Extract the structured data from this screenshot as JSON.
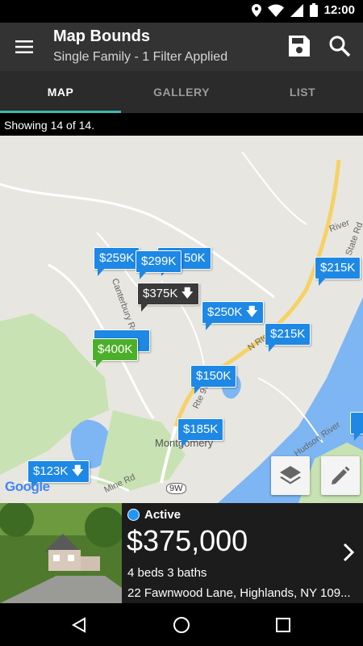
{
  "status_bar": {
    "time": "12:00"
  },
  "app_bar": {
    "title": "Map Bounds",
    "subtitle": "Single Family - 1 Filter Applied"
  },
  "tabs": [
    {
      "label": "MAP",
      "active": true
    },
    {
      "label": "GALLERY",
      "active": false
    },
    {
      "label": "LIST",
      "active": false
    }
  ],
  "results": {
    "text": "Showing 14 of 14."
  },
  "map": {
    "pins": {
      "p1": "$259K",
      "p2": "50K",
      "p3": "$299K",
      "p4": "$375K",
      "p5": "$250K",
      "p6": "$215K",
      "p7": "$215K",
      "p8": "$400K",
      "p9": "$150K",
      "p10": "$185K",
      "p11": "$123K"
    },
    "labels": {
      "town": "Montgomery",
      "road_9w": "9W",
      "mine_rd": "Mine Rd",
      "canterbury": "Canterbury Rd",
      "n_rte": "N Rte",
      "rte_9w": "Rte 9W",
      "state_rd": "State Rd",
      "river": "River",
      "hudson": "Hudson River"
    },
    "google": "Google"
  },
  "listing": {
    "status": "Active",
    "price": "$375,000",
    "beds_baths": "4 beds 3 baths",
    "address": "22 Fawnwood Lane, Highlands, NY 109..."
  },
  "colors": {
    "accent": "#3fb9ae",
    "pin_blue": "#1e88e5",
    "pin_selected": "#3a3a3a",
    "pin_green": "#4caf2a",
    "water": "#7eb6f3",
    "park": "#c8e2b3"
  }
}
